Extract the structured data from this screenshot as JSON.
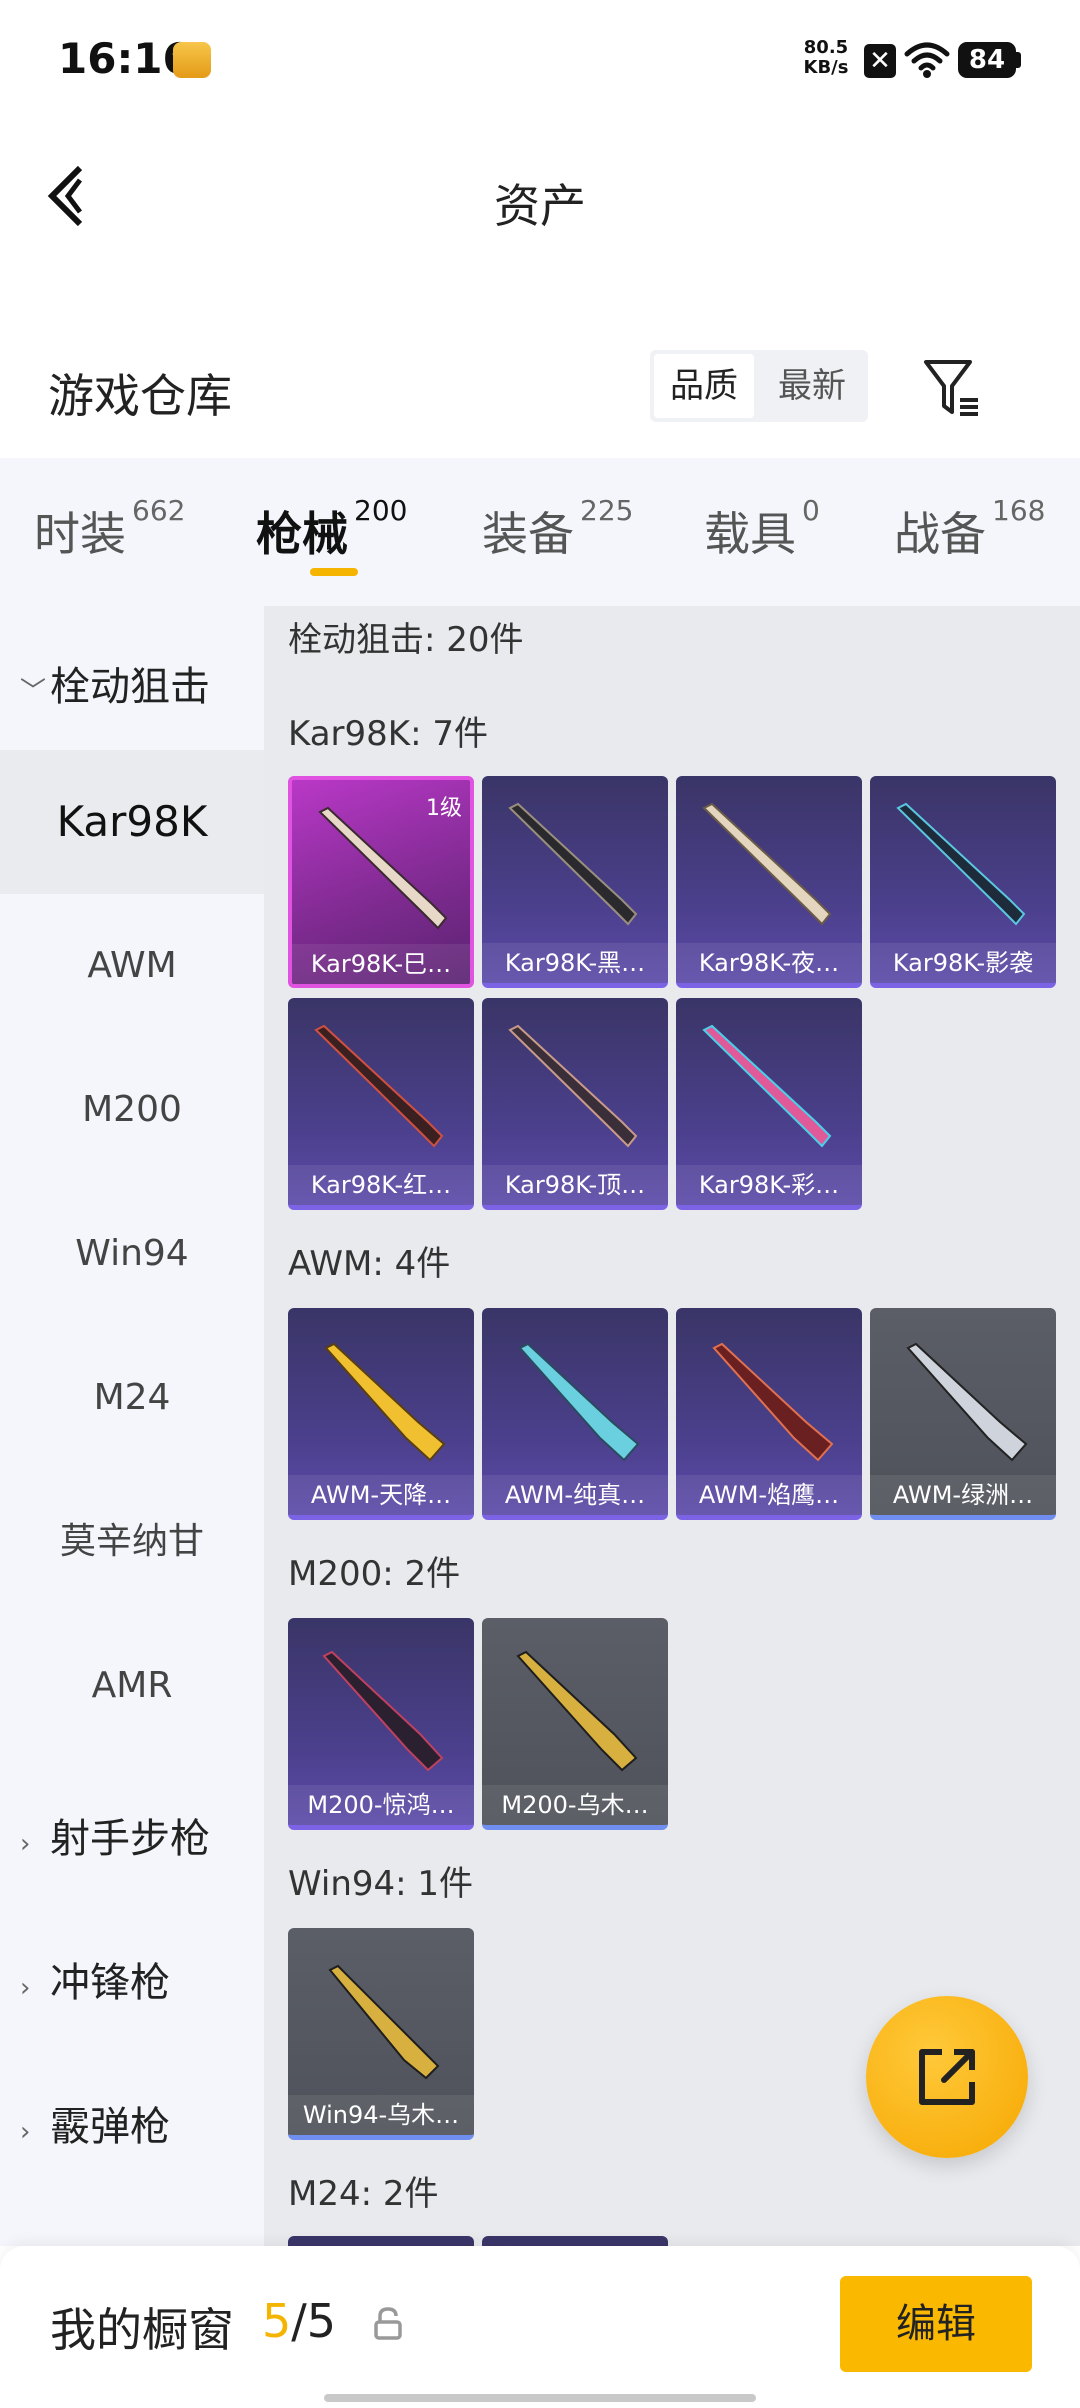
{
  "status_bar": {
    "time": "16:16",
    "speed_value": "80.5",
    "speed_unit": "KB/s",
    "x_badge": "✕",
    "battery": "84"
  },
  "header": {
    "title": "资产"
  },
  "warehouse": {
    "title": "游戏仓库",
    "sort_options": [
      "品质",
      "最新"
    ]
  },
  "tabs": [
    {
      "label": "时装",
      "count": "662"
    },
    {
      "label": "枪械",
      "count": "200"
    },
    {
      "label": "装备",
      "count": "225"
    },
    {
      "label": "载具",
      "count": "0"
    },
    {
      "label": "战备",
      "count": "168"
    }
  ],
  "sidebar": {
    "groups": {
      "bolt": "栓动狙击",
      "marksman": "射手步枪",
      "smg": "冲锋枪",
      "shotgun": "霰弹枪"
    },
    "items": [
      "Kar98K",
      "AWM",
      "M200",
      "Win94",
      "M24",
      "莫辛纳甘",
      "AMR"
    ]
  },
  "main": {
    "category_summary": "栓动狙击: 20件",
    "sections": {
      "kar98k": "Kar98K: 7件",
      "awm": "AWM: 4件",
      "m200": "M200: 2件",
      "win94": "Win94: 1件",
      "m24": "M24: 2件"
    },
    "kar98k_items": [
      {
        "name": "Kar98K-巳…",
        "level": "1级"
      },
      {
        "name": "Kar98K-黑…"
      },
      {
        "name": "Kar98K-夜…"
      },
      {
        "name": "Kar98K-影袭"
      },
      {
        "name": "Kar98K-红…"
      },
      {
        "name": "Kar98K-顶…"
      },
      {
        "name": "Kar98K-彩…"
      }
    ],
    "awm_items": [
      {
        "name": "AWM-天降…"
      },
      {
        "name": "AWM-纯真…"
      },
      {
        "name": "AWM-焰鹰…"
      },
      {
        "name": "AWM-绿洲…"
      }
    ],
    "m200_items": [
      {
        "name": "M200-惊鸿…"
      },
      {
        "name": "M200-乌木…"
      }
    ],
    "win94_items": [
      {
        "name": "Win94-乌木…"
      }
    ]
  },
  "bottom_bar": {
    "label": "我的橱窗",
    "count_current": "5",
    "count_sep": "/",
    "count_total": "5",
    "edit_label": "编辑"
  },
  "colors": {
    "accent": "#f5b400",
    "edit_button": "#fbb800",
    "card_purple": "#4a3f8a",
    "card_pink": "#b938c7",
    "card_gray": "#555860"
  },
  "icons": {
    "back": "back-arrow-icon",
    "filter": "filter-icon",
    "share": "share-icon",
    "lock": "lock-icon"
  }
}
